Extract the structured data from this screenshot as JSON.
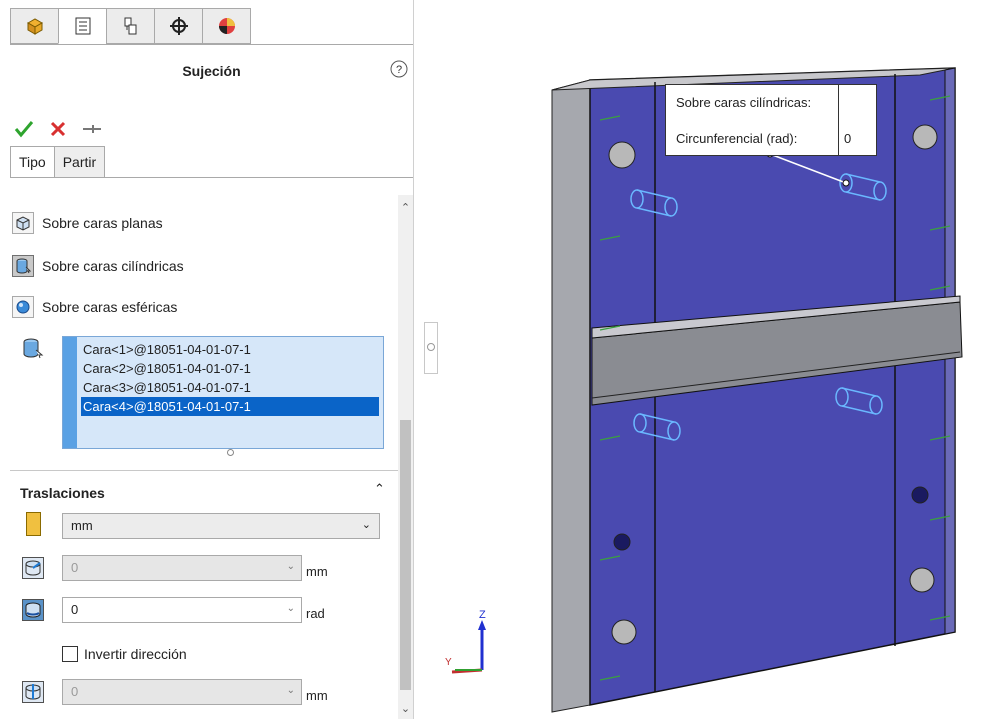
{
  "toptabs": {
    "icons": [
      "feature-manager-icon",
      "property-manager-icon",
      "configuration-manager-icon",
      "dimxpert-icon",
      "display-manager-icon"
    ],
    "colors": {
      "yellow": "#f0c040",
      "blue": "#1a60c0",
      "red": "#d83030"
    }
  },
  "panel": {
    "title": "Sujeción",
    "help": "?",
    "tabs": [
      "Tipo",
      "Partir"
    ]
  },
  "options": {
    "planas": "Sobre caras planas",
    "cilindricas": "Sobre caras cilíndricas",
    "esfericas": "Sobre caras esféricas"
  },
  "faces": [
    "Cara<1>@18051-04-01-07-1",
    "Cara<2>@18051-04-01-07-1",
    "Cara<3>@18051-04-01-07-1",
    "Cara<4>@18051-04-01-07-1"
  ],
  "selected_face_index": 3,
  "traslaciones": {
    "heading": "Traslaciones",
    "unit_value": "mm",
    "field1": {
      "value": "0",
      "unit": "mm"
    },
    "field2": {
      "value": "0",
      "unit": "rad"
    },
    "invert_label": "Invertir dirección",
    "field3": {
      "value": "0",
      "unit": "mm"
    }
  },
  "callout": {
    "row1": "Sobre caras cilíndricas:",
    "row2_label": "Circunferencial (rad):",
    "row2_value": "0"
  },
  "triad": {
    "z": "Z",
    "y": "Y"
  },
  "colors": {
    "accent": "#1f7bd4",
    "plate": "#4a4ab0",
    "select_bg": "#d6e7f9",
    "check": "#2ea42e",
    "cross": "#d83030"
  }
}
